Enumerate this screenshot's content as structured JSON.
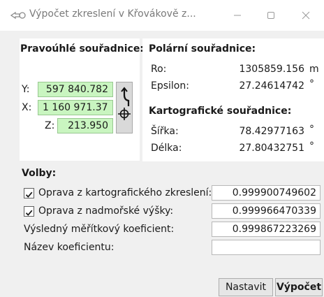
{
  "window": {
    "title": "Výpočet zkreslení v Křovákově z...",
    "minimize_icon": "minimize-icon",
    "maximize_icon": "maximize-icon",
    "close_icon": "close-icon"
  },
  "pravouhle": {
    "title": "Pravoúhlé souřadnice:",
    "y_label": "Y:",
    "y_value": "597 840.782",
    "x_label": "X:",
    "x_value": "1 160 971.376",
    "z_label": "Z:",
    "z_value": "213.950",
    "field_color": "#c9f5c0",
    "convert_icon": "arrow-crosshair-icon"
  },
  "polarni": {
    "title": "Polární souřadnice:",
    "ro_label": "Ro:",
    "ro_value": "1305859.156",
    "ro_unit": "m",
    "eps_label": "Epsilon:",
    "eps_value": "27.24614742",
    "eps_unit": "°"
  },
  "kartograficke": {
    "title": "Kartografické souřadnice:",
    "sirka_label": "Šířka:",
    "sirka_value": "78.42977163",
    "sirka_unit": "°",
    "delka_label": "Délka:",
    "delka_value": "27.80432751",
    "delka_unit": "°"
  },
  "volby": {
    "title": "Volby:",
    "opt1_label": "Oprava z kartografického zkreslení:",
    "opt1_value": "0.999900749602",
    "opt1_checked": true,
    "opt2_label": "Oprava z nadmořské výšky:",
    "opt2_value": "0.999966470339",
    "opt2_checked": true,
    "result_label": "Výsledný měřítkový koeficient:",
    "result_value": "0.999867223269",
    "name_label": "Název koeficientu:",
    "name_value": ""
  },
  "buttons": {
    "nastavit": "Nastavit",
    "vypocet": "Výpočet"
  }
}
